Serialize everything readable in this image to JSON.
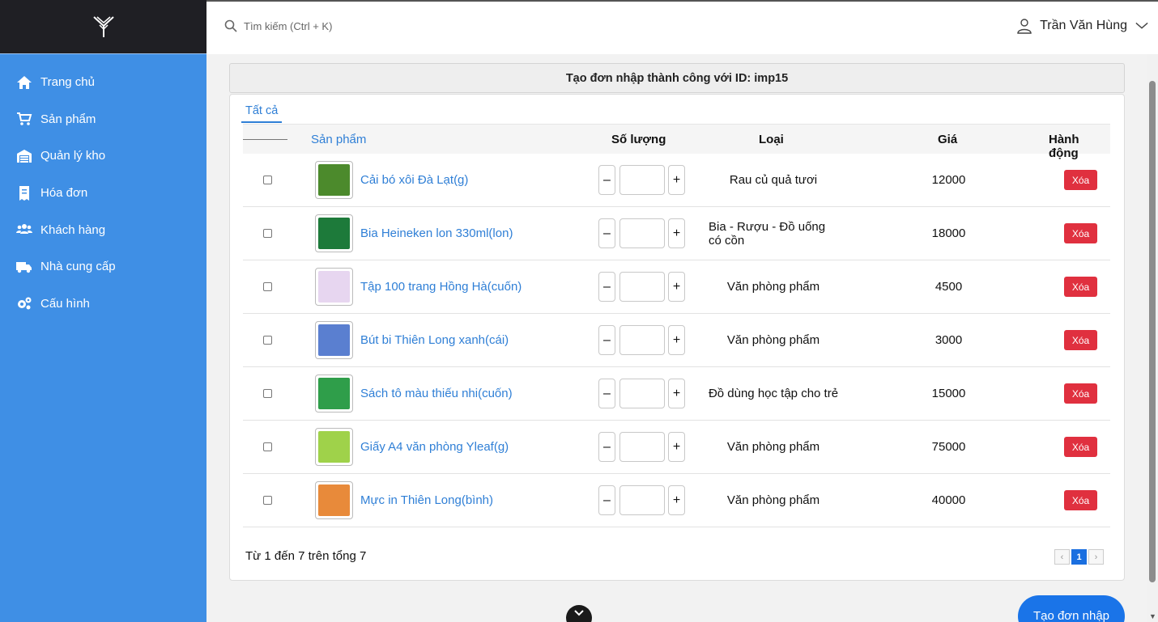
{
  "sidebar": {
    "items": [
      {
        "label": "Trang chủ",
        "icon": "home-icon"
      },
      {
        "label": "Sản phẩm",
        "icon": "cart-icon"
      },
      {
        "label": "Quản lý kho",
        "icon": "warehouse-icon"
      },
      {
        "label": "Hóa đơn",
        "icon": "receipt-icon"
      },
      {
        "label": "Khách hàng",
        "icon": "users-icon"
      },
      {
        "label": "Nhà cung cấp",
        "icon": "truck-icon"
      },
      {
        "label": "Cấu hình",
        "icon": "gears-icon"
      }
    ]
  },
  "topbar": {
    "search_placeholder": "Tìm kiếm (Ctrl + K)",
    "user_name": "Trần Văn Hùng"
  },
  "banner": "Tạo đơn nhập thành công với ID: imp15",
  "tabs": {
    "all": "Tất cả"
  },
  "table": {
    "headers": {
      "product": "Sản phẩm",
      "quantity": "Số lượng",
      "category": "Loại",
      "price": "Giá",
      "action": "Hành động"
    },
    "qty_minus": "–",
    "qty_plus": "+",
    "delete_label": "Xóa",
    "rows": [
      {
        "name": "Cải bó xôi Đà Lạt(g)",
        "category": "Rau củ quả tươi",
        "price": "12000",
        "thumb_color": "#4c8a2c"
      },
      {
        "name": "Bia Heineken lon 330ml(lon)",
        "category": "Bia - Rượu - Đồ uống có cồn",
        "price": "18000",
        "thumb_color": "#1d7a3a"
      },
      {
        "name": "Tập 100 trang Hồng Hà(cuốn)",
        "category": "Văn phòng phẩm",
        "price": "4500",
        "thumb_color": "#e7d6f0"
      },
      {
        "name": "Bút bi Thiên Long xanh(cái)",
        "category": "Văn phòng phẩm",
        "price": "3000",
        "thumb_color": "#5a7fd0"
      },
      {
        "name": "Sách tô màu thiếu nhi(cuốn)",
        "category": "Đồ dùng học tập cho trẻ",
        "price": "15000",
        "thumb_color": "#2f9e4a"
      },
      {
        "name": "Giấy A4 văn phòng Yleaf(g)",
        "category": "Văn phòng phẩm",
        "price": "75000",
        "thumb_color": "#9fd24a"
      },
      {
        "name": "Mực in Thiên Long(bình)",
        "category": "Văn phòng phẩm",
        "price": "40000",
        "thumb_color": "#e88a3a"
      }
    ]
  },
  "footer": {
    "summary": "Từ 1 đến 7 trên tổng 7",
    "prev": "‹",
    "page": "1",
    "next": "›"
  },
  "create_button": "Tạo đơn nhập",
  "colors": {
    "sidebar": "#3f8fe5",
    "accent": "#2f7fd6",
    "danger": "#e0303f"
  }
}
